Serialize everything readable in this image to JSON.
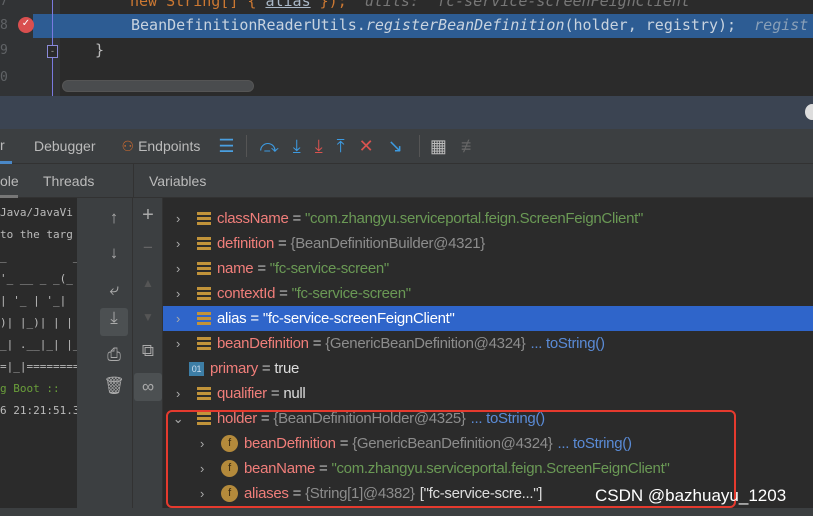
{
  "editor": {
    "lines": [
      {
        "num": "7",
        "code_prefix": "new String[] { ",
        "code_alias": "alias",
        "code_suffix": " });",
        "hint": "utils: \"fc-service-screenFeignClient\""
      },
      {
        "num": "8",
        "code": "BeanDefinitionReaderUtils.",
        "method": "registerBeanDefinition",
        "args": "(holder, registry);",
        "hint": "regist"
      },
      {
        "num": "9",
        "code": "}"
      },
      {
        "num": "0"
      }
    ]
  },
  "toolbar": {
    "tabs": [
      {
        "label": "r"
      },
      {
        "label": "Debugger"
      },
      {
        "label": "Endpoints"
      }
    ],
    "icons": [
      "show-execution-point-icon",
      "step-over-icon",
      "step-into-icon",
      "force-step-into-icon",
      "step-out-icon",
      "drop-frame-icon",
      "run-to-cursor-icon",
      "evaluate-expression-icon",
      "trace-icon"
    ]
  },
  "subtabs": {
    "console": "ole",
    "threads": "Threads",
    "variables": "Variables"
  },
  "console": {
    "lines": [
      "Java/JavaVi",
      "to the targ",
      "",
      "_          _",
      "'_ __ _ _(_",
      "| '_ | '_|",
      ")| |_)| | |",
      "_| .__|_| |_",
      "=|_|=========",
      "g Boot ::",
      "",
      "6 21:21:51.3"
    ]
  },
  "variables": [
    {
      "name": "className",
      "value": "\"com.zhangyu.serviceportal.feign.ScreenFeignClient\"",
      "kind": "str",
      "icon": "field-icon"
    },
    {
      "name": "definition",
      "value": "{BeanDefinitionBuilder@4321}",
      "kind": "obj",
      "icon": "field-icon"
    },
    {
      "name": "name",
      "value": "\"fc-service-screen\"",
      "kind": "str",
      "icon": "field-icon"
    },
    {
      "name": "contextId",
      "value": "\"fc-service-screen\"",
      "kind": "str",
      "icon": "field-icon"
    },
    {
      "name": "alias",
      "value": "\"fc-service-screenFeignClient\"",
      "kind": "str",
      "icon": "field-icon",
      "selected": true
    },
    {
      "name": "beanDefinition",
      "value": "{GenericBeanDefinition@4324}",
      "link": "... toString()",
      "kind": "obj",
      "icon": "field-icon"
    },
    {
      "name": "primary",
      "value": "true",
      "kind": "kw",
      "icon": "boolean-icon"
    },
    {
      "name": "qualifier",
      "value": "null",
      "kind": "kw",
      "icon": "field-icon"
    },
    {
      "name": "holder",
      "value": "{BeanDefinitionHolder@4325}",
      "link": "... toString()",
      "kind": "obj",
      "icon": "field-icon",
      "expanded": true
    },
    {
      "name": "beanDefinition",
      "value": "{GenericBeanDefinition@4324}",
      "link": "... toString()",
      "kind": "obj",
      "icon": "final-field-icon",
      "child": true
    },
    {
      "name": "beanName",
      "value": "\"com.zhangyu.serviceportal.feign.ScreenFeignClient\"",
      "kind": "str",
      "icon": "final-field-icon",
      "child": true
    },
    {
      "name": "aliases",
      "value": "{String[1]@4382}",
      "extra": "[\"fc-service-scre...\"]",
      "kind": "obj",
      "icon": "final-field-icon",
      "child": true
    }
  ],
  "watermark": "CSDN @bazhuayu_1203",
  "colors": {
    "highlight": "#2d5c93",
    "selection": "#2f65ca",
    "annotation": "#e53a2e"
  }
}
